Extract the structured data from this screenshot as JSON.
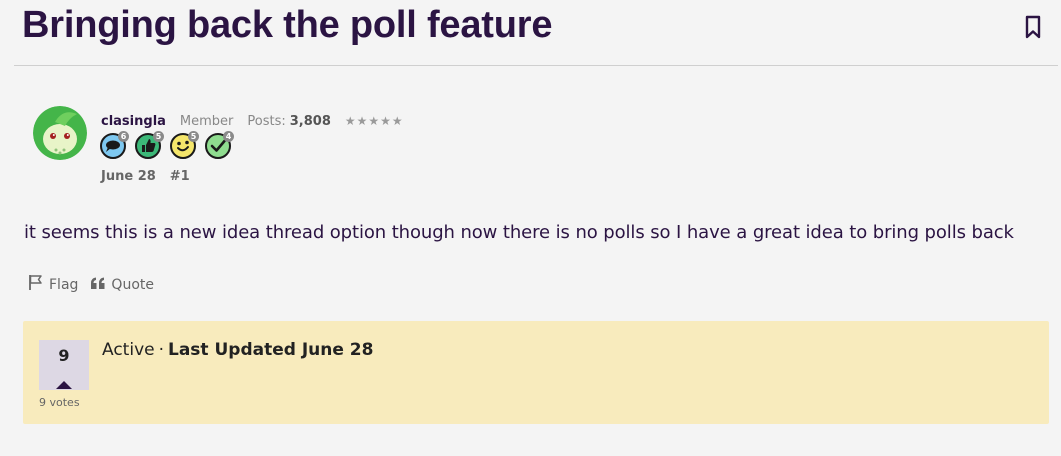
{
  "discussion": {
    "title": "Bringing back the poll feature",
    "bookmark_icon": "bookmark-icon"
  },
  "post": {
    "author": {
      "username": "clasingla",
      "role": "Member",
      "posts_label": "Posts:",
      "posts_count": "3,808",
      "rank_stars": "★★★★★"
    },
    "badges": [
      {
        "name": "comment-badge-icon",
        "count": "6",
        "color": "#7ec8f0"
      },
      {
        "name": "thumbs-up-badge-icon",
        "count": "5",
        "color": "#3cb878"
      },
      {
        "name": "smiley-badge-icon",
        "count": "5",
        "color": "#f5e66b"
      },
      {
        "name": "checkmark-badge-icon",
        "count": "4",
        "color": "#8fdc8f"
      }
    ],
    "date": "June 28",
    "permalink": "#1",
    "body": "it seems this is a new idea thread option though now there is no polls so I have a great idea to bring polls back",
    "actions": {
      "flag": "Flag",
      "quote": "Quote"
    }
  },
  "idea_status": {
    "votes": "9",
    "votes_label": "9 votes",
    "status": "Active",
    "separator": "·",
    "last_updated": "Last Updated June 28"
  },
  "colors": {
    "title": "#2b1443",
    "panel_bg": "#f8ebbd",
    "vote_box_bg": "#ddd8e4",
    "page_bg": "#f4f4f4"
  }
}
